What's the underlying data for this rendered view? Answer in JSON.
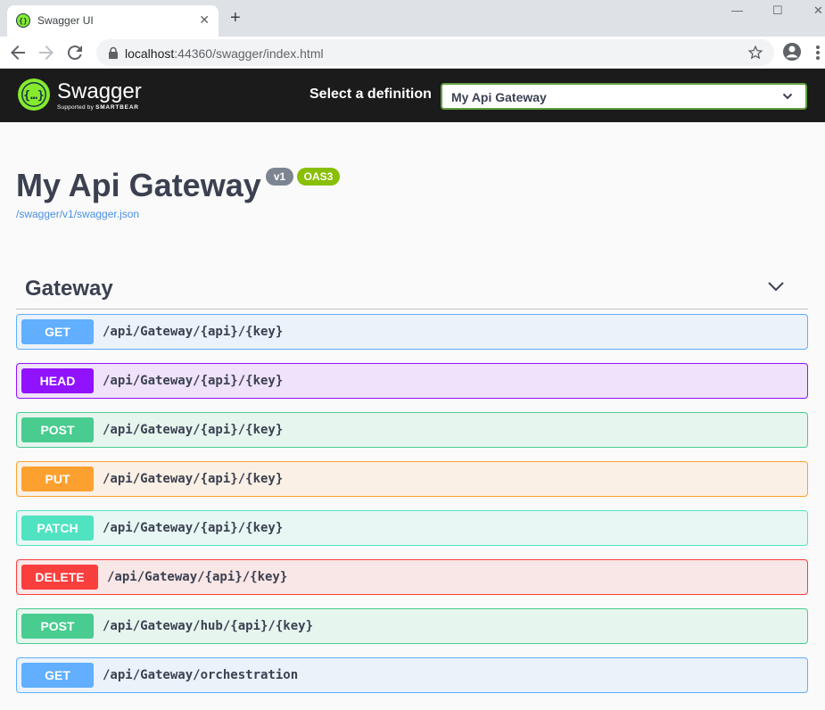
{
  "browser": {
    "tab_title": "Swagger UI",
    "tab_close": "✕",
    "new_tab": "+",
    "url_host": "localhost",
    "url_rest": ":44360/swagger/index.html",
    "window_controls": {
      "minimize": "—",
      "maximize": "☐",
      "close": "✕"
    }
  },
  "topbar": {
    "logo_text": "Swagger",
    "logo_sub_prefix": "Supported by ",
    "logo_sub_brand": "SMARTBEAR",
    "definition_label": "Select a definition",
    "definition_selected": "My Api Gateway"
  },
  "info": {
    "title": "My Api Gateway",
    "version": "v1",
    "oas": "OAS3",
    "spec_url": "/swagger/v1/swagger.json"
  },
  "tag": {
    "name": "Gateway",
    "operations": [
      {
        "method": "GET",
        "path": "/api/Gateway/{api}/{key}"
      },
      {
        "method": "HEAD",
        "path": "/api/Gateway/{api}/{key}"
      },
      {
        "method": "POST",
        "path": "/api/Gateway/{api}/{key}"
      },
      {
        "method": "PUT",
        "path": "/api/Gateway/{api}/{key}"
      },
      {
        "method": "PATCH",
        "path": "/api/Gateway/{api}/{key}"
      },
      {
        "method": "DELETE",
        "path": "/api/Gateway/{api}/{key}"
      },
      {
        "method": "POST",
        "path": "/api/Gateway/hub/{api}/{key}"
      },
      {
        "method": "GET",
        "path": "/api/Gateway/orchestration"
      }
    ]
  },
  "colors": {
    "get": "#61affe",
    "head": "#9012fe",
    "post": "#49cc90",
    "put": "#fca130",
    "patch": "#50e3c2",
    "delete": "#f93e3e",
    "topbar": "#1b1b1b",
    "link": "#4990e2"
  },
  "icons": {
    "favicon": "swagger-favicon-icon",
    "back": "back-arrow-icon",
    "forward": "forward-arrow-icon",
    "reload": "reload-icon",
    "lock": "lock-icon",
    "bookmark": "star-icon",
    "profile": "account-icon",
    "menu": "kebab-menu-icon",
    "logo": "swagger-logo-icon",
    "select_chevron": "chevron-down-icon",
    "tag_chevron": "chevron-down-icon"
  }
}
